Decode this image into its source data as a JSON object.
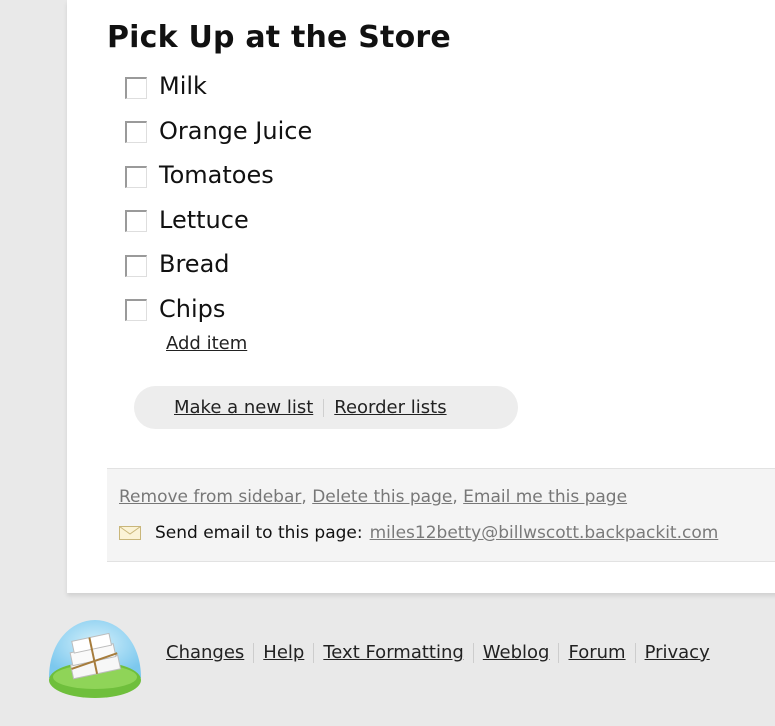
{
  "list": {
    "title": "Pick Up at the Store",
    "items": [
      {
        "label": "Milk",
        "checked": false
      },
      {
        "label": "Orange Juice",
        "checked": false
      },
      {
        "label": "Tomatoes",
        "checked": false
      },
      {
        "label": "Lettuce",
        "checked": false
      },
      {
        "label": "Bread",
        "checked": false
      },
      {
        "label": "Chips",
        "checked": false
      }
    ],
    "add_item_label": "Add item"
  },
  "list_actions": {
    "new_list_label": "Make a new list",
    "reorder_label": "Reorder lists"
  },
  "page_actions": {
    "remove_label": "Remove from sidebar",
    "delete_label": "Delete this page",
    "email_me_label": "Email me this page",
    "comma": ", "
  },
  "email": {
    "prompt": "Send email to this page:",
    "address": "miles12betty@billwscott.backpackit.com"
  },
  "footer_links": {
    "changes": "Changes",
    "help": "Help",
    "text_formatting": "Text Formatting",
    "weblog": "Weblog",
    "forum": "Forum",
    "privacy": "Privacy"
  },
  "icons": {
    "checkbox": "checkbox-icon",
    "envelope": "envelope-icon",
    "logo": "backpack-logo"
  },
  "colors": {
    "background": "#e9e9e9",
    "page": "#ffffff",
    "link_gray": "#777777",
    "logo_sky": "#8fd2f2",
    "logo_grass": "#6fbf3c"
  }
}
